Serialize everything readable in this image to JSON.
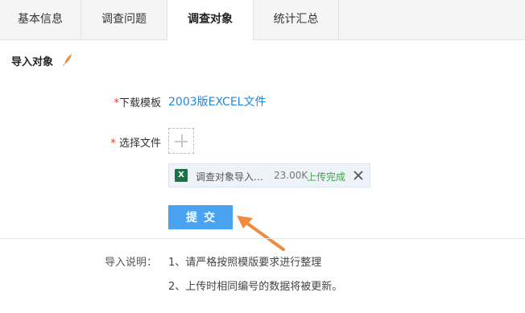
{
  "tabs": [
    {
      "label": "基本信息"
    },
    {
      "label": "调查问题"
    },
    {
      "label": "调查对象"
    },
    {
      "label": "统计汇总"
    }
  ],
  "active_tab": "调查对象",
  "section": {
    "title": "导入对象"
  },
  "form": {
    "download_label": "下载模板",
    "download_link": "2003版EXCEL文件",
    "file_label": "选择文件",
    "required_mark": "*",
    "file": {
      "name": "调查对象导入…",
      "size": "23.00K",
      "status": "上传完成"
    },
    "submit_label": "提交"
  },
  "notes": {
    "label": "导入说明：",
    "items": [
      "1、请严格按照模版要求进行整理",
      "2、上传时相同编号的数据将被更新。"
    ]
  },
  "colors": {
    "accent": "#4aa3f0",
    "link": "#1e88e5",
    "success": "#43a047",
    "required": "#e53935",
    "arrow": "#f08a3c"
  },
  "icons": {
    "section": "pen-icon",
    "add": "plus-icon",
    "file": "excel-icon",
    "remove": "close-icon",
    "annotation": "arrow-icon"
  }
}
